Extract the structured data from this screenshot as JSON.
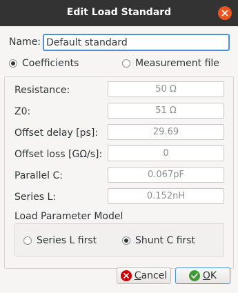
{
  "window": {
    "title": "Edit Load Standard",
    "close_icon": "close-icon"
  },
  "name": {
    "label": "Name:",
    "value": "Default standard"
  },
  "mode": {
    "coefficients_label": "Coefficients",
    "measurement_file_label": "Measurement file",
    "selected": "Coefficients"
  },
  "params": [
    {
      "label": "Resistance:",
      "value": "50 Ω"
    },
    {
      "label": "Z0:",
      "value": "51 Ω"
    },
    {
      "label": "Offset delay [ps]:",
      "value": "29.69"
    },
    {
      "label": "Offset loss [GΩ/s]:",
      "value": "0"
    },
    {
      "label": "Parallel C:",
      "value": "0.067pF"
    },
    {
      "label": "Series L:",
      "value": "0.152nH"
    }
  ],
  "load_model": {
    "title": "Load Parameter Model",
    "series_l_first_label": "Series L first",
    "shunt_c_first_label": "Shunt C first",
    "selected": "Shunt C first"
  },
  "buttons": {
    "cancel_label_mnemonic": "C",
    "cancel_label_rest": "ancel",
    "ok_label_mnemonic": "O",
    "ok_label_rest": "K"
  },
  "colors": {
    "titlebar": "#333333",
    "close_button": "#e9541f",
    "cancel_icon": "#cc0000",
    "ok_icon": "#3e9a35",
    "focus": "#4a90d9"
  }
}
